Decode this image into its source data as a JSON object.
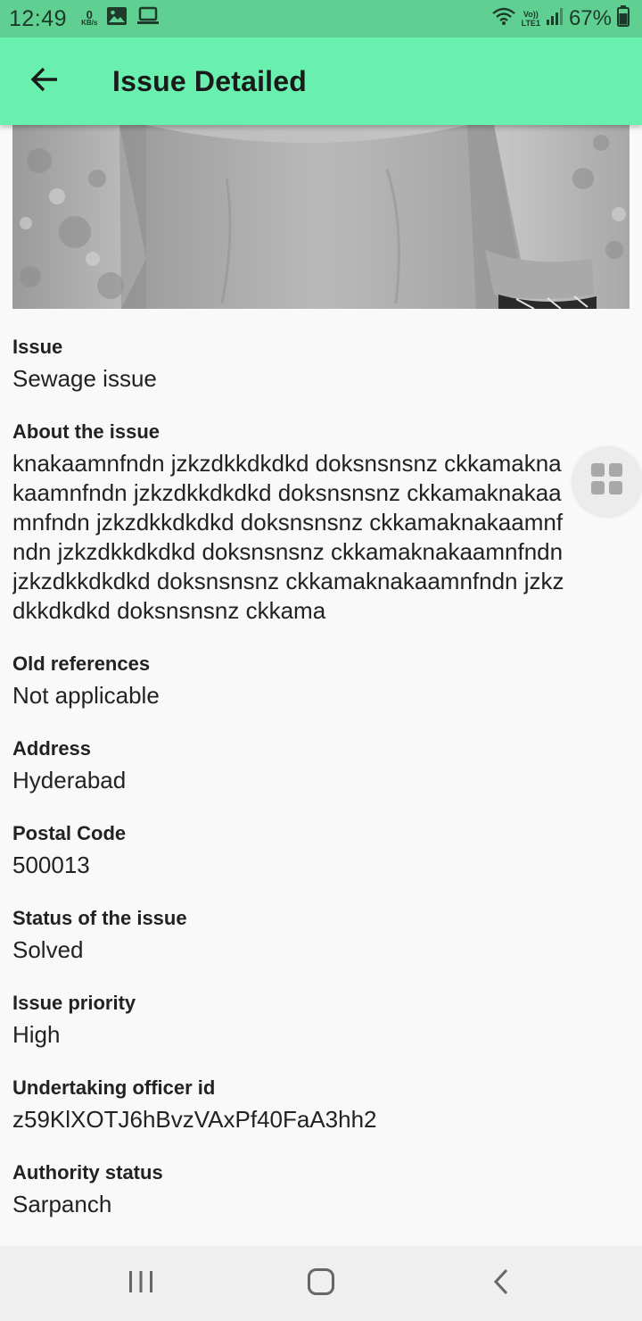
{
  "status_bar": {
    "time": "12:49",
    "data_rate_value": "0",
    "data_rate_unit": "KB/s",
    "network_vo": "Vo))",
    "network_lte": "LTE1",
    "battery": "67%",
    "icons": [
      "gallery-icon",
      "laptop-icon",
      "wifi-icon",
      "signal-icon",
      "battery-icon"
    ]
  },
  "app_bar": {
    "title": "Issue Detailed",
    "back_icon": "arrow-left-icon"
  },
  "fields": [
    {
      "label": "Issue",
      "value": "Sewage issue"
    },
    {
      "label": "About the issue",
      "value": "knakaamnfndn jzkzdkkdkdkd doksnsnsnz ckkamaknakaamnfndn jzkzdkkdkdkd doksnsnsnz ckkamaknakaamnfndn jzkzdkkdkdkd doksnsnsnz ckkamaknakaamnfndn jzkzdkkdkdkd doksnsnsnz ckkamaknakaamnfndn jzkzdkkdkdkd doksnsnsnz ckkamaknakaamnfndn jzkzdkkdkdkd doksnsnsnz ckkama"
    },
    {
      "label": "Old references",
      "value": "Not applicable"
    },
    {
      "label": "Address",
      "value": "Hyderabad"
    },
    {
      "label": "Postal Code",
      "value": "500013"
    },
    {
      "label": "Status of the issue",
      "value": "Solved"
    },
    {
      "label": "Issue priority",
      "value": "High"
    },
    {
      "label": "Undertaking officer id",
      "value": "z59KlXOTJ6hBvzVAxPf40FaA3hh2"
    },
    {
      "label": "Authority status",
      "value": "Sarpanch"
    }
  ],
  "floating_button": {
    "icon": "grid-icon"
  },
  "nav_bar": {
    "icons": [
      "recent-apps-icon",
      "home-icon",
      "back-icon"
    ]
  },
  "colors": {
    "app_bar": "#69f0ae",
    "status_bar": "#5fcf92",
    "background": "#f9f9f9"
  }
}
